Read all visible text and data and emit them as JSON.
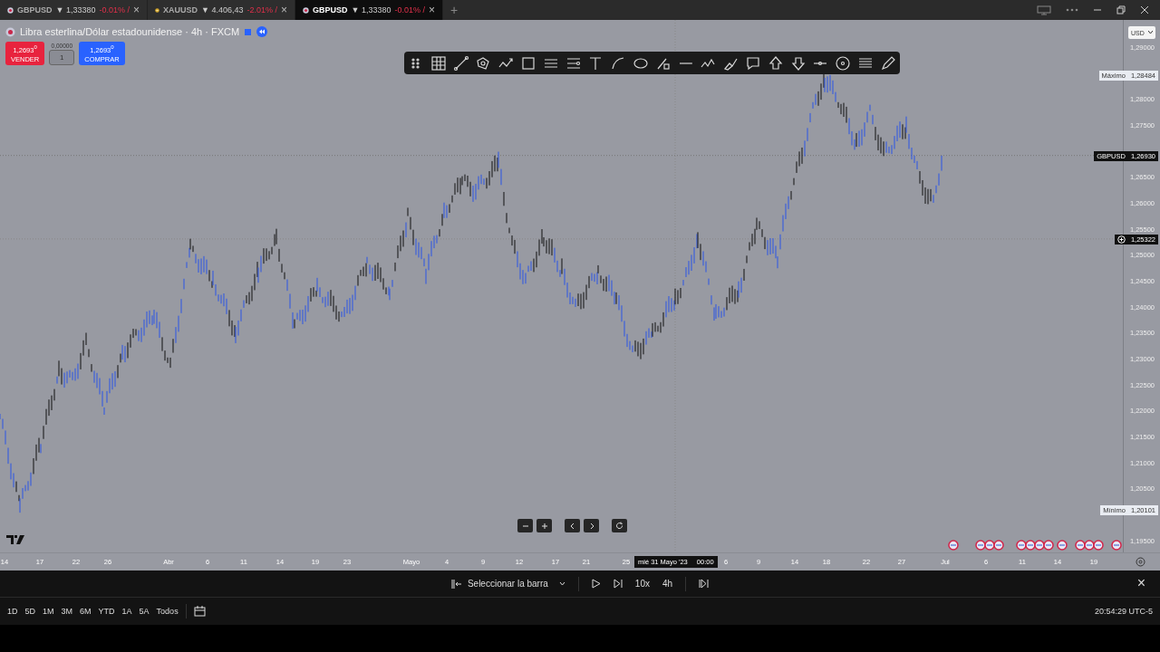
{
  "tabs": [
    {
      "kind": "currency-pair",
      "symbol": "GBPUSD",
      "price": "▼ 1,33380",
      "change": "-0.01% /",
      "close": "×",
      "selected": false
    },
    {
      "kind": "commodity",
      "symbol": "XAUUSD",
      "price": "▼ 4.406,43",
      "change": "-2.01% /",
      "close": "×",
      "selected": false
    },
    {
      "kind": "currency-pair",
      "symbol": "GBPUSD",
      "price": "▼ 1,33380",
      "change": "-0.01% /",
      "close": "×",
      "selected": true
    }
  ],
  "new_tab": "+",
  "header": {
    "title": "Libra esterlina/Dólar estadounidense · 4h · FXCM"
  },
  "trade": {
    "sell": {
      "price": "1,2693$^{0}$",
      "label": "VENDER"
    },
    "spread": "0,00000",
    "quantity": "1",
    "buy": {
      "price": "1,2693$^{0}$",
      "label": "COMPRAR"
    }
  },
  "price_axis": {
    "currency": "USD",
    "ticks": [
      "1,29000",
      "1,28000",
      "1,27500",
      "1,26500",
      "1,26000",
      "1,25500",
      "1,25000",
      "1,24500",
      "1,24000",
      "1,23500",
      "1,23000",
      "1,22500",
      "1,22000",
      "1,21500",
      "1,21000",
      "1,20500",
      "1,19500"
    ],
    "high": {
      "label": "Máximo",
      "value": "1,28484"
    },
    "last": {
      "symbol": "GBPUSD",
      "value": "1,26930"
    },
    "crosshair": {
      "value": "1,25322"
    },
    "low": {
      "label": "Mínimo",
      "value": "1,20101"
    }
  },
  "time_axis": {
    "labels": [
      "14",
      "17",
      "22",
      "26",
      "Abr",
      "6",
      "11",
      "14",
      "19",
      "23",
      "Mayo",
      "4",
      "9",
      "12",
      "17",
      "21",
      "25",
      "6",
      "9",
      "14",
      "18",
      "22",
      "27",
      "Jul",
      "6",
      "11",
      "14",
      "19"
    ],
    "crosshair_date": "mié 31 Mayo '23",
    "crosshair_time": "00:00"
  },
  "replay": {
    "select_bar": "Seleccionar la barra",
    "speed": "10x",
    "interval": "4h",
    "close": "×"
  },
  "ranges": [
    "1D",
    "5D",
    "1M",
    "3M",
    "6M",
    "YTD",
    "1A",
    "5A",
    "Todos"
  ],
  "clock": "20:54:29 UTC-5"
}
